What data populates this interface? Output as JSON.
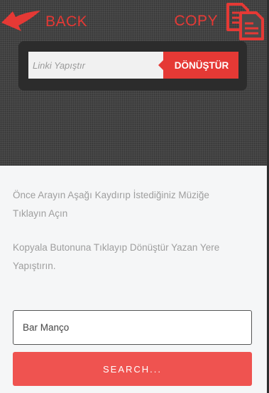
{
  "header": {
    "back_label": "BACK",
    "back_icon": "arrow-left-icon",
    "copy_label": "COPY",
    "copy_icon": "copy-document-icon",
    "accent_color": "#e53935"
  },
  "url_bar": {
    "placeholder": "Linki Yapıştır",
    "value": "",
    "convert_label": "DÖNÜŞTÜR"
  },
  "instructions": [
    "Önce Arayın Aşağı Kaydırıp İstediğiniz Müziğe Tıklayın Açın",
    "Kopyala Butonuna Tıklayıp Dönüştür Yazan Yere Yapıştırın."
  ],
  "search": {
    "value": "Bar Manço",
    "button_label": "SEARCH..."
  }
}
